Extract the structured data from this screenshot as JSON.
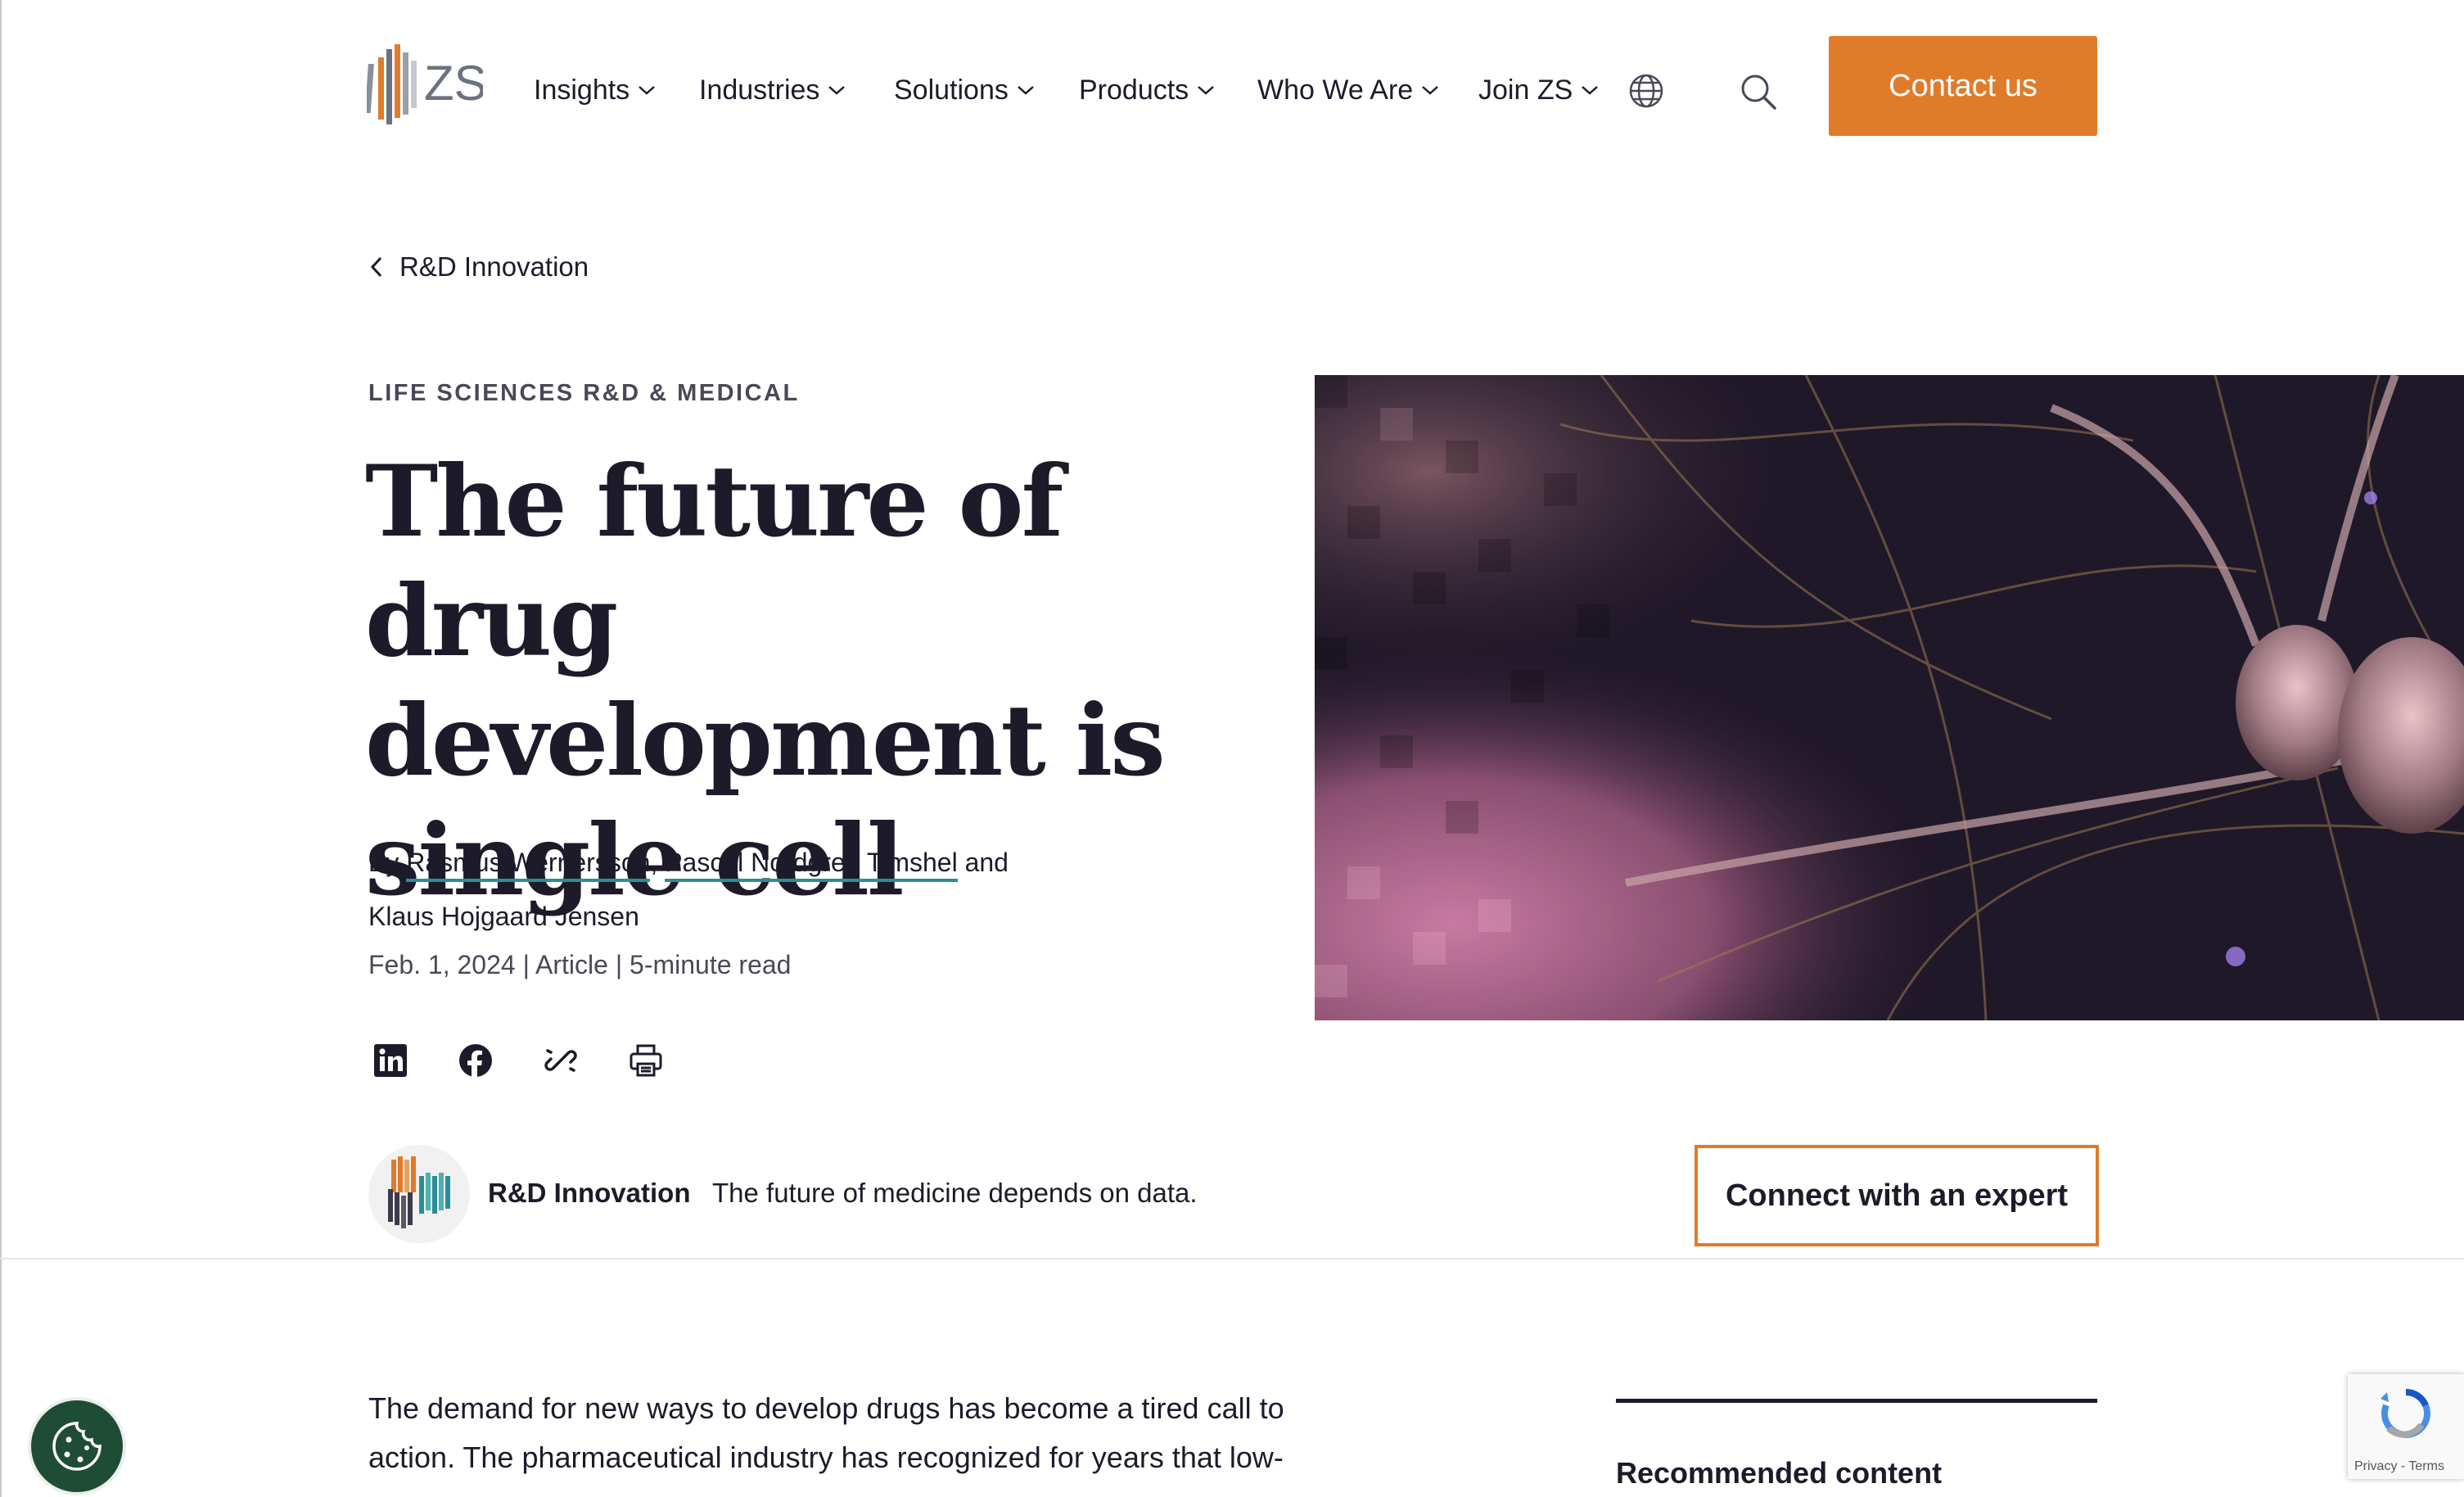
{
  "brand": {
    "name": "ZS"
  },
  "nav": {
    "items": [
      {
        "label": "Insights"
      },
      {
        "label": "Industries"
      },
      {
        "label": "Solutions"
      },
      {
        "label": "Products"
      },
      {
        "label": "Who We Are"
      },
      {
        "label": "Join ZS"
      }
    ],
    "contact_label": "Contact us"
  },
  "breadcrumb": {
    "label": "R&D Innovation"
  },
  "article": {
    "category": "LIFE SCIENCES R&D & MEDICAL",
    "title_lines": [
      "The future of drug",
      "development is",
      "single cell"
    ],
    "by_prefix": "By",
    "authors": [
      "Rasmus Wernersson",
      "Pascal Nordgren Timshel",
      "Klaus Hojgaard Jensen"
    ],
    "author_sep": ",",
    "author_and": "and",
    "meta": "Feb. 1, 2024 | Article | 5-minute read"
  },
  "share": {
    "icons": [
      "linkedin-icon",
      "facebook-icon",
      "link-icon",
      "print-icon"
    ]
  },
  "topic": {
    "name": "R&D Innovation",
    "description": "The future of medicine depends on data.",
    "expert_label": "Connect with an expert"
  },
  "body": {
    "intro": "The demand for new ways to develop drugs has become a tired call to action. The pharmaceutical industry has recognized for years that low-"
  },
  "sidebar": {
    "recommended_title": "Recommended content"
  },
  "recaptcha": {
    "text": "Privacy - Terms"
  },
  "colors": {
    "accent": "#e07b2a",
    "teal": "#2a8f94",
    "ink": "#1d1b2a",
    "cookie": "#1e4c35"
  }
}
